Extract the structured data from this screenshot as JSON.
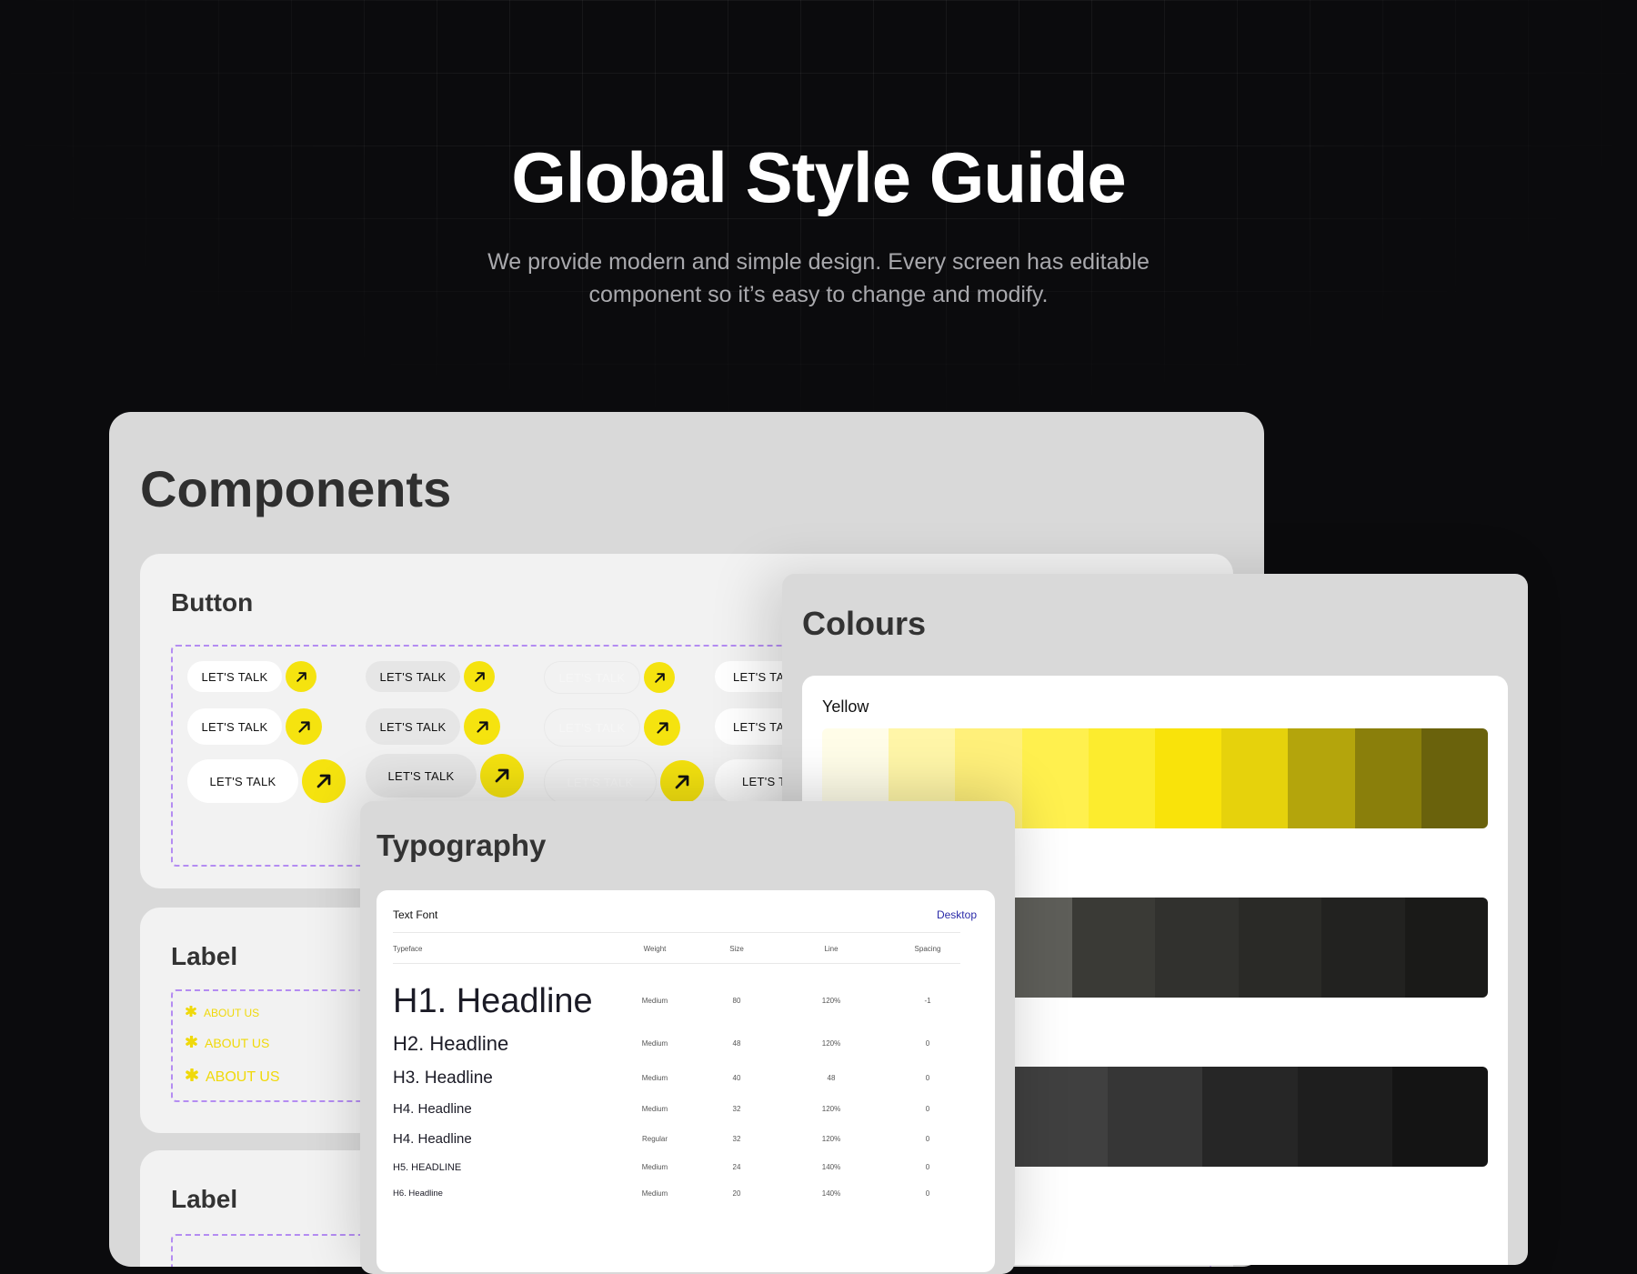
{
  "hero": {
    "title": "Global Style Guide",
    "subtitle_line1": "We provide modern and simple design. Every screen has editable",
    "subtitle_line2": "component so it’s easy to change and modify."
  },
  "components": {
    "title": "Components",
    "button_card": {
      "title": "Button",
      "button_label": "LET'S TALK",
      "truncated_label_1": "LET'S TAL",
      "truncated_label_2": "LET'S TA"
    },
    "label_card_1": {
      "title": "Label",
      "items": [
        "ABOUT US",
        "ABOUT US",
        "ABOUT US"
      ]
    },
    "label_card_2": {
      "title": "Label"
    }
  },
  "colours": {
    "title": "Colours",
    "palette_name": "Yellow",
    "yellow_swatches": [
      "#fffde8",
      "#fff6a8",
      "#fff07a",
      "#fff04e",
      "#fcec2e",
      "#f9e30a",
      "#e6d20c",
      "#b4a50c",
      "#8a7f0b",
      "#6a620c"
    ],
    "grey_swatches": [
      "#9a9a96",
      "#7a7a74",
      "#5e5e59",
      "#3a3a36",
      "#31312e",
      "#2a2a27",
      "#222220",
      "#1a1a18"
    ],
    "dark_swatches": [
      "#505050",
      "#4a4a4a",
      "#404040",
      "#363636",
      "#262626",
      "#1e1e1e",
      "#141414"
    ]
  },
  "typography": {
    "title": "Typography",
    "text_font_label": "Text Font",
    "device_label": "Desktop",
    "headers": [
      "Typeface",
      "Weight",
      "Size",
      "Line",
      "Spacing"
    ],
    "rows": [
      {
        "name": "H1. Headline",
        "weight": "Medium",
        "size": "80",
        "line": "120%",
        "spacing": "-1"
      },
      {
        "name": "H2. Headline",
        "weight": "Medium",
        "size": "48",
        "line": "120%",
        "spacing": "0"
      },
      {
        "name": "H3. Headline",
        "weight": "Medium",
        "size": "40",
        "line": "48",
        "spacing": "0"
      },
      {
        "name": "H4. Headline",
        "weight": "Medium",
        "size": "32",
        "line": "120%",
        "spacing": "0"
      },
      {
        "name": "H4. Headline",
        "weight": "Regular",
        "size": "32",
        "line": "120%",
        "spacing": "0"
      },
      {
        "name": "H5. HEADLINE",
        "weight": "Medium",
        "size": "24",
        "line": "140%",
        "spacing": "0"
      },
      {
        "name": "H6. Headline",
        "weight": "Medium",
        "size": "20",
        "line": "140%",
        "spacing": "0"
      }
    ]
  }
}
